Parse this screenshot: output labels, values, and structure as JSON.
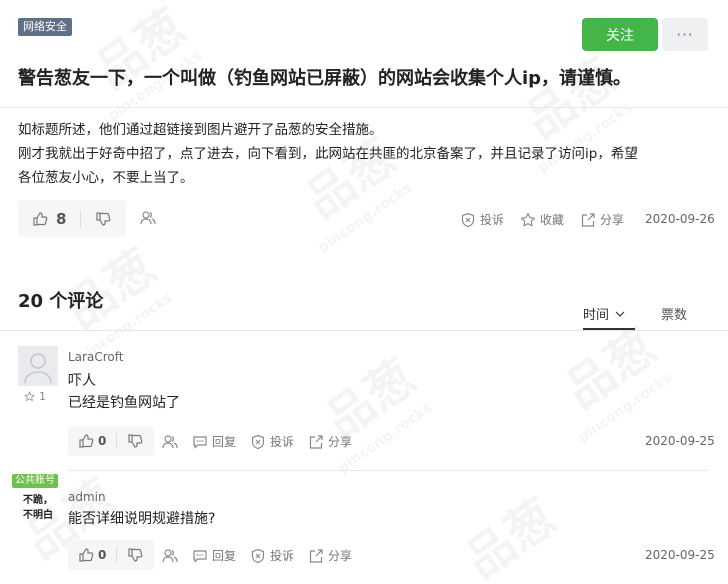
{
  "post": {
    "tag": "网络安全",
    "follow_label": "关注",
    "more_label": "···",
    "title": "警告葱友一下，一个叫做（钓鱼网站已屏蔽）的网站会收集个人ip，请谨慎。",
    "body_lines": [
      "如标题所述，他们通过超链接到图片避开了品葱的安全措施。",
      "刚才我就出于好奇中招了，点了进去，向下看到，此网站在共匪的北京备案了，并且记录了访问ip，希望",
      "各位葱友小心，不要上当了。"
    ],
    "upvotes": "8",
    "report_label": "投诉",
    "favorite_label": "收藏",
    "share_label": "分享",
    "date": "2020-09-26"
  },
  "comments_header": {
    "title": "20 个评论",
    "sort_time_label": "时间",
    "sort_votes_label": "票数"
  },
  "comments": [
    {
      "username": "LaraCroft",
      "star_count": "1",
      "lines": [
        "吓人",
        "已经是钓鱼网站了"
      ],
      "upvotes": "0",
      "reply_label": "回复",
      "report_label": "投诉",
      "share_label": "分享",
      "date": "2020-09-25"
    },
    {
      "badge": "公共账号",
      "avatar_lines": [
        "不跪，",
        "不明白"
      ],
      "username": "admin",
      "lines": [
        "能否详细说明规避措施?"
      ],
      "upvotes": "0",
      "reply_label": "回复",
      "report_label": "投诉",
      "share_label": "分享",
      "date": "2020-09-25"
    }
  ],
  "watermark": {
    "big": "品葱",
    "small": "pincong.rocks"
  },
  "colors": {
    "follow": "#44b549",
    "tag": "#5f6f86",
    "badge": "#6cc24a"
  }
}
